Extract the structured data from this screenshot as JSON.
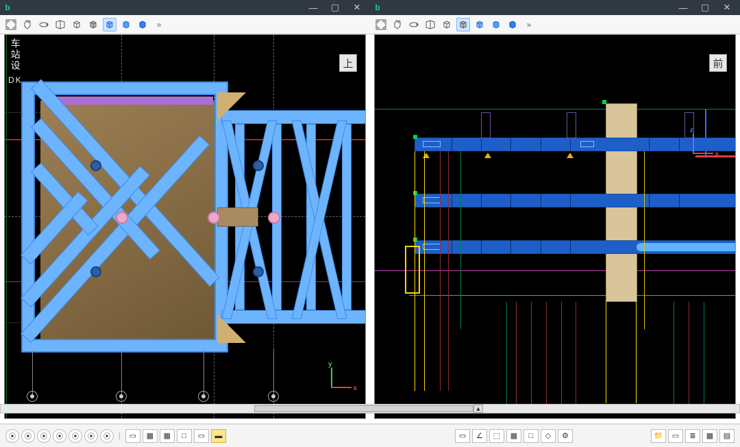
{
  "window_left": {
    "app_icon_letter": "b",
    "controls": {
      "minimize": "—",
      "maximize": "▢",
      "close": "✕"
    },
    "toolbar": {
      "fit": "fit-view",
      "pan": "pan",
      "rotate": "orbit",
      "section": "section",
      "box1": "cube-wire",
      "box2": "cube-shaded",
      "box3": "cube-iso",
      "box4": "cube-solid",
      "box5": "cube-blue",
      "more": "»"
    },
    "view_button": "上",
    "vertical_label": {
      "line1": "车站设",
      "line2": "DK"
    },
    "gizmo": {
      "x": "x",
      "y": "y"
    }
  },
  "window_right": {
    "app_icon_letter": "b",
    "controls": {
      "minimize": "—",
      "maximize": "▢",
      "close": "✕"
    },
    "toolbar": {
      "fit": "fit-view",
      "pan": "pan",
      "rotate": "orbit",
      "section": "section",
      "box1": "cube-wire",
      "box2": "cube-shaded",
      "box3": "cube-iso",
      "box4": "cube-solid",
      "box5": "cube-blue",
      "more": "»"
    },
    "view_button": "前",
    "gizmo": {
      "x": "x",
      "z": "z"
    }
  },
  "footer": {
    "left_round_buttons": [
      "⦿",
      "⦿",
      "⦿",
      "⦿",
      "⦿",
      "⦿",
      "⦿"
    ],
    "left_sep": "|",
    "left_square_buttons": [
      "▭",
      "▦",
      "▦",
      "□",
      "▭",
      "▬"
    ],
    "center_square_buttons": [
      "▭",
      "∠",
      "⬚",
      "▦",
      "□",
      "◇",
      "⚙"
    ],
    "right_square_buttons": [
      "📁",
      "▭",
      "≣",
      "▦",
      "▤"
    ]
  },
  "scrollbar": {
    "arrow": "▲"
  },
  "colors": {
    "beam_fill": "#6db4ff",
    "beam_stroke": "#3f8ae0",
    "slab": "#c7a97a",
    "purple": "#aa6ed4",
    "pink": "#e9a9c8",
    "blue_dot": "#2a5fa8",
    "axis_x": "#e04040",
    "axis_y": "#40d040",
    "axis_z": "#4080ff",
    "magenta": "#d040b0",
    "cyan": "#30c0d0",
    "yellow": "#ffd800",
    "green800": "#008040",
    "red800": "#903030",
    "amber": "#f0b000"
  }
}
